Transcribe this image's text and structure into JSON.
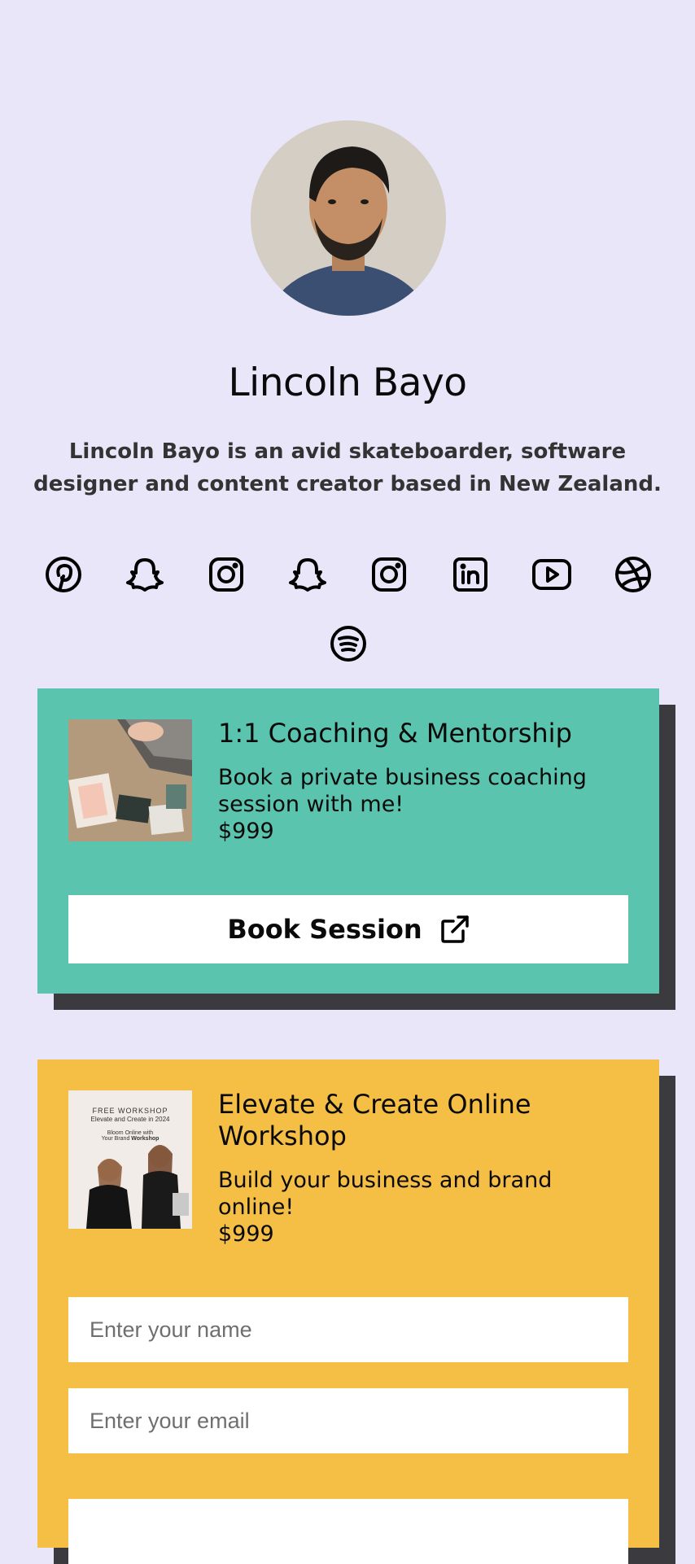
{
  "profile": {
    "name": "Lincoln Bayo",
    "bio": "Lincoln Bayo is an avid skateboarder, software designer and content creator based in New Zealand."
  },
  "social_icons": [
    "pinterest-icon",
    "snapchat-icon",
    "instagram-icon",
    "snapchat-icon",
    "instagram-icon",
    "linkedin-icon",
    "youtube-icon",
    "dribbble-icon",
    "spotify-icon"
  ],
  "cards": [
    {
      "title": "1:1 Coaching & Mentorship",
      "description": "Book a private business coaching session with me!",
      "price": "$999",
      "button_label": "Book Session",
      "color": "#5ac4ae"
    },
    {
      "title": "Elevate & Create Online Workshop",
      "description": "Build your business and brand online!",
      "price": "$999",
      "thumb_text": {
        "line1": "FREE WORKSHOP",
        "line2": "Elevate and Create in 2024",
        "line3": "Bloom Online with",
        "line4a": "Your Brand ",
        "line4b": "Workshop"
      },
      "name_placeholder": "Enter your name",
      "email_placeholder": "Enter your email",
      "color": "#f5bf46"
    }
  ],
  "colors": {
    "background": "#e8e6f8",
    "shadow": "#3b3a3f",
    "text": "#0a0a0a"
  }
}
